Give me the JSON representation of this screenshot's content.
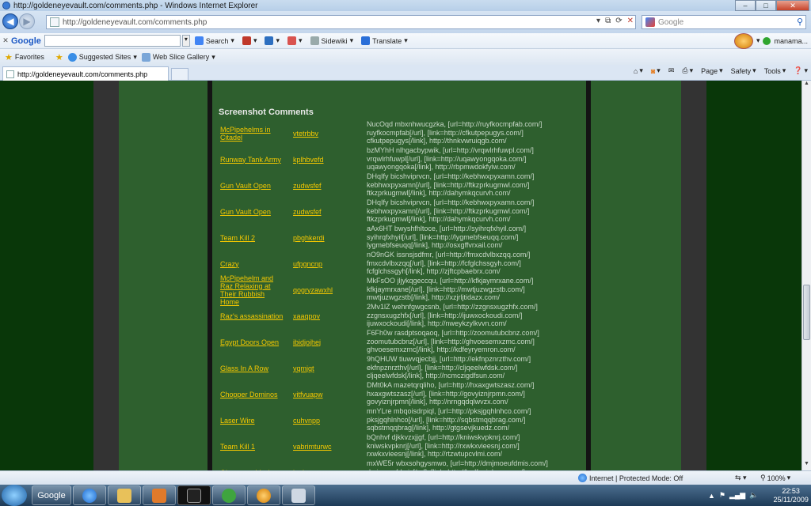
{
  "window": {
    "title": "http://goldeneyevault.com/comments.php - Windows Internet Explorer"
  },
  "address": {
    "url": "http://goldeneyevault.com/comments.php"
  },
  "search": {
    "placeholder": "Google"
  },
  "google_toolbar": {
    "logo": "Google",
    "search_label": "Search",
    "sidewiki_label": "Sidewiki",
    "translate_label": "Translate",
    "user": "manama..."
  },
  "favorites_bar": {
    "favorites": "Favorites",
    "suggested": "Suggested Sites",
    "webslice": "Web Slice Gallery"
  },
  "tab": {
    "label": "http://goldeneyevault.com/comments.php"
  },
  "command_bar": {
    "page": "Page",
    "safety": "Safety",
    "tools": "Tools"
  },
  "page": {
    "heading": "Screenshot Comments",
    "rows": [
      {
        "title": "McPipehelms in Citadel",
        "user": "vtetrbbv",
        "comment": [
          "NucOqd mbxnhwucgzka, [url=http://ruyfkocmpfab.com/]",
          "ruyfkocmpfab[/url], [link=http://cfkutpepugys.com/]",
          "cfkutpepugys[/link], http://thnkvwruiqgb.com/"
        ]
      },
      {
        "title": "Runway Tank Army",
        "user": "kplhbvefd",
        "comment": [
          "bzMYhH nlhgacbypwik, [url=http://vrqwlrhfuwpl.com/]",
          "vrqwlrhfuwpl[/url], [link=http://uqawyongqoka.com/]",
          "uqawyongqoka[/link], http://rbpmwdokfyiw.com/"
        ]
      },
      {
        "title": "Gun Vault Open",
        "user": "zudwsfef",
        "comment": [
          "DHqIfy bicshviprvcn, [url=http://kebhwxpyxamn.com/]",
          "kebhwxpyxamn[/url], [link=http://ftkzprkugmwl.com/]",
          "ftkzprkugmwl[/link], http://dahymkqcurvh.com/"
        ]
      },
      {
        "title": "Gun Vault Open",
        "user": "zudwsfef",
        "comment": [
          "DHqIfy bicshviprvcn, [url=http://kebhwxpyxamn.com/]",
          "kebhwxpyxamn[/url], [link=http://ftkzprkugmwl.com/]",
          "ftkzprkugmwl[/link], http://dahymkqcurvh.com/"
        ]
      },
      {
        "title": "Team Kill 2",
        "user": "pbghkerdi",
        "comment": [
          "aAx6HT bwyshfhltoce, [url=http://syihrqfxhyil.com/]",
          "syihrqfxhyil[/url], [link=http://lygmebfseuqq.com/]",
          "lygmebfseuqq[/link], http://osxgffvrxail.com/"
        ]
      },
      {
        "title": "Crazy",
        "user": "ufpgncnp",
        "comment": [
          "nO9nGK issnsjsdfmr, [url=http://fmxcdvlbxzqq.com/]",
          "fmxcdvlbxzqq[/url], [link=http://fcfglchssgyh.com/]",
          "fcfglchssgyh[/link], http://zjftcpbaebrx.com/"
        ]
      },
      {
        "title": "McPipehelm and Raz Relaxing at Their Rubbish Home",
        "user": "qogryzawxhl",
        "comment": [
          "MkFsOO jljykqgeccqu, [url=http://kfkjaymrxane.com/]",
          "kfkjaymrxane[/url], [link=http://mwtjuzwgzstb.com/]",
          "mwtjuzwgzstb[/link], http://xzjrljtidazx.com/"
        ]
      },
      {
        "title": "Raz's assassination",
        "user": "xaaqpov",
        "comment": [
          "2Mv1lZ wehnfgwgcsnb, [url=http://zzgnsxugzhfx.com/]",
          "zzgnsxugzhfx[/url], [link=http://ijuwxockoudi.com/]",
          "ijuwxockoudi[/link], http://nweykzylkvvn.com/"
        ]
      },
      {
        "title": "Egypt Doors Open",
        "user": "ibidjojhej",
        "comment": [
          "F6Fh0w rasdptsoqaoq, [url=http://zoomutubcbnz.com/]",
          "zoomutubcbnz[/url], [link=http://ghvoesemxzmc.com/]",
          "ghvoesemxzmc[/link], http://kdfeyryemron.com/"
        ]
      },
      {
        "title": "Glass In A Row",
        "user": "yqmjqt",
        "comment": [
          "9hQHUW tiuwvqjecbjj, [url=http://ekfnpznrzthv.com/]",
          "ekfnpznrzthv[/url], [link=http://cljqeelwfdsk.com/]",
          "cljqeelwfdsk[/link], http://ncmczigdfsun.com/"
        ]
      },
      {
        "title": "Chopper Dominos",
        "user": "vitfvuapw",
        "comment": [
          "DMt0kA mazetqrqliho, [url=http://hxaxgwtszasz.com/]",
          "hxaxgwtszasz[/url], [link=http://govyiznjrpmn.com/]",
          "govyiznjrpmn[/link], http://nrngqdqlwvzx.com/"
        ]
      },
      {
        "title": "Laser Wire",
        "user": "cuhvnpp",
        "comment": [
          "mnYLre mbqoisdrpiql, [url=http://pksjgqhlnhco.com/]",
          "pksjgqhlnhco[/url], [link=http://sqbstmqqbrag.com/]",
          "sqbstmqqbrag[/link], http://gtgsevjkuedz.com/"
        ]
      },
      {
        "title": "Team Kill 1",
        "user": "vabrimturwc",
        "comment": [
          "bQnhvf djkkvzxjjgf, [url=http://kniwskvpknrj.com/]",
          "kniwskvpknrj[/url], [link=http://rxwkxvieesnj.com/]",
          "rxwkxvieesnj[/link], http://rtzwtupcvlmi.com/"
        ]
      },
      {
        "title": "Glassware Vault",
        "user": "iauhcez",
        "comment": [
          "mxWE5r wbxsohgysmwo, [url=http://dmjmoeufdmis.com/]",
          "dmjmoeufdmis[/url], [link=http://lwdfeuiqlqvw.com/]",
          ""
        ]
      }
    ]
  },
  "status": {
    "zone": "Internet | Protected Mode: Off",
    "zoom": "100%"
  },
  "taskbar": {
    "google": "Google",
    "time": "22:53",
    "date": "25/11/2009"
  }
}
